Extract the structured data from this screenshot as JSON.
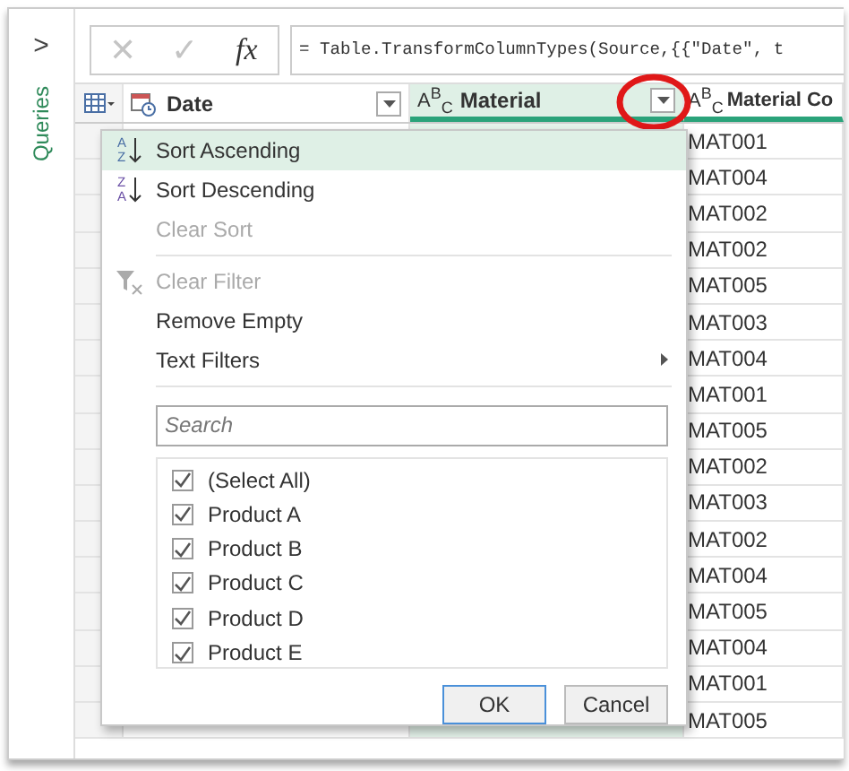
{
  "queries_pane": {
    "expand": ">",
    "label": "Queries"
  },
  "formula_bar": {
    "cancel": "✕",
    "confirm": "✓",
    "fx": "fx",
    "formula": "= Table.TransformColumnTypes(Source,{{\"Date\", t"
  },
  "table": {
    "columns": [
      {
        "name": "Date",
        "kind": "date",
        "selected": false
      },
      {
        "name": "Material",
        "kind": "text",
        "type_label": "A$^{B}$$_{C}$",
        "selected": true
      },
      {
        "name": "Material Co",
        "kind": "text",
        "type_label": "A$^{B}$$_{C}$",
        "selected": false
      }
    ],
    "material_code_cells": [
      "MAT001",
      "MAT004",
      "MAT002",
      "MAT002",
      "MAT005",
      "MAT003",
      "MAT004",
      "MAT001",
      "MAT005",
      "MAT002",
      "MAT003",
      "MAT002",
      "MAT004",
      "MAT005",
      "MAT004",
      "MAT001",
      "MAT005"
    ]
  },
  "filter_menu": {
    "items": [
      {
        "kind": "sort-ascending",
        "label": "Sort Ascending",
        "icon_top": "A",
        "icon_bottom": "Z",
        "disabled": false,
        "selected": true
      },
      {
        "kind": "sort-descending",
        "label": "Sort Descending",
        "icon_top": "Z",
        "icon_bottom": "A",
        "disabled": false,
        "selected": false
      },
      {
        "kind": "plain",
        "label": "Clear Sort",
        "disabled": true,
        "selected": false
      },
      {
        "kind": "separator"
      },
      {
        "kind": "clear-filter",
        "label": "Clear Filter",
        "disabled": true,
        "selected": false
      },
      {
        "kind": "plain",
        "label": "Remove Empty",
        "disabled": false,
        "selected": false
      },
      {
        "kind": "submenu",
        "label": "Text Filters",
        "disabled": false,
        "selected": false
      },
      {
        "kind": "separator"
      }
    ],
    "search": {
      "placeholder": "Search"
    },
    "values": [
      {
        "label": "(Select All)",
        "checked": true
      },
      {
        "label": "Product A",
        "checked": true
      },
      {
        "label": "Product B",
        "checked": true
      },
      {
        "label": "Product C",
        "checked": true
      },
      {
        "label": "Product D",
        "checked": true
      },
      {
        "label": "Product E",
        "checked": true
      }
    ],
    "buttons": [
      "OK",
      "Cancel"
    ]
  }
}
